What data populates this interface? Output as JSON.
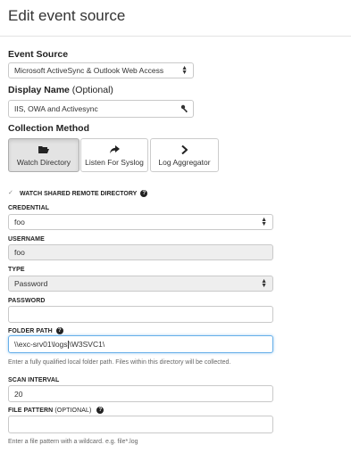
{
  "page": {
    "title": "Edit event source"
  },
  "event_source": {
    "label": "Event Source",
    "value": "Microsoft ActiveSync & Outlook Web Access"
  },
  "display_name": {
    "label": "Display Name",
    "optional": "(Optional)",
    "value": "IIS, OWA and Activesync"
  },
  "collection_method": {
    "label": "Collection Method",
    "options": [
      {
        "label": "Watch Directory",
        "icon": "folder-open-icon",
        "active": true
      },
      {
        "label": "Listen For Syslog",
        "icon": "share-arrow-icon",
        "active": false
      },
      {
        "label": "Log Aggregator",
        "icon": "chevron-right-icon",
        "active": false
      }
    ]
  },
  "watch_shared": {
    "label": "WATCH SHARED REMOTE DIRECTORY",
    "checked": true
  },
  "credential": {
    "label": "CREDENTIAL",
    "value": "foo"
  },
  "username": {
    "label": "USERNAME",
    "value": "foo"
  },
  "type": {
    "label": "TYPE",
    "value": "Password"
  },
  "password": {
    "label": "PASSWORD",
    "value": ""
  },
  "folder_path": {
    "label": "FOLDER PATH",
    "value_before_cursor": "\\\\exc-srv01\\logs",
    "value_after_cursor": "\\W3SVC1\\",
    "help": "Enter a fully qualified local folder path. Files within this directory will be collected."
  },
  "scan_interval": {
    "label": "SCAN INTERVAL",
    "value": "20"
  },
  "file_pattern": {
    "label": "FILE PATTERN",
    "optional": "(OPTIONAL)",
    "value": "",
    "help": "Enter a file pattern with a wildcard. e.g. file*.log"
  },
  "colors": {
    "focus": "#66afe9",
    "active_button": "#e3e3e3",
    "disabled_field": "#eeeeee"
  }
}
